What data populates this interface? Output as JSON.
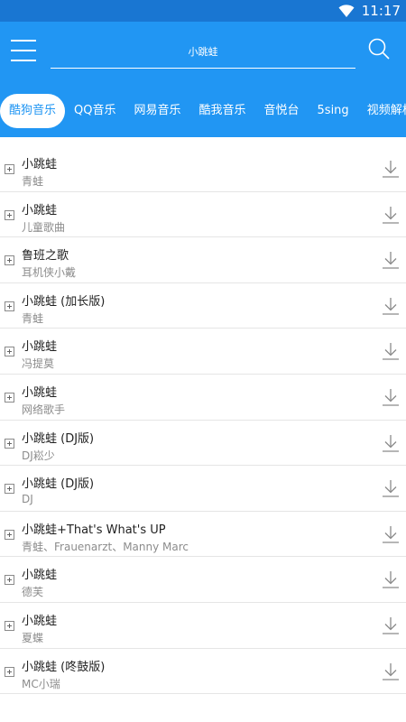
{
  "status": {
    "time": "11:17"
  },
  "search": {
    "value": "小跳蛙"
  },
  "tabs": [
    {
      "label": "酷狗音乐",
      "active": true
    },
    {
      "label": "QQ音乐"
    },
    {
      "label": "网易音乐"
    },
    {
      "label": "酷我音乐"
    },
    {
      "label": "音悦台"
    },
    {
      "label": "5sing"
    },
    {
      "label": "视频解析"
    }
  ],
  "songs": [
    {
      "title": "小跳蛙",
      "artist": "青蛙"
    },
    {
      "title": "小跳蛙",
      "artist": "儿童歌曲"
    },
    {
      "title": "鲁班之歌",
      "artist": "耳机侠小戴"
    },
    {
      "title": "小跳蛙 (加长版)",
      "artist": "青蛙"
    },
    {
      "title": "小跳蛙",
      "artist": "冯提莫"
    },
    {
      "title": "小跳蛙",
      "artist": "网络歌手"
    },
    {
      "title": "小跳蛙 (DJ版)",
      "artist": "DJ崧少"
    },
    {
      "title": "小跳蛙 (DJ版)",
      "artist": "DJ"
    },
    {
      "title": "小跳蛙+That's What's UP",
      "artist": "青蛙、Frauenarzt、Manny Marc"
    },
    {
      "title": "小跳蛙",
      "artist": "德芙"
    },
    {
      "title": "小跳蛙",
      "artist": "夏蝶"
    },
    {
      "title": "小跳蛙 (咚鼓版)",
      "artist": "MC小瑞"
    }
  ],
  "colors": {
    "primary": "#2196f3",
    "statusbar": "#1976d2"
  },
  "icons": {
    "menu": "menu-icon",
    "search": "search-icon",
    "download": "download-icon",
    "expand": "expand-icon",
    "wifi": "wifi-icon"
  }
}
